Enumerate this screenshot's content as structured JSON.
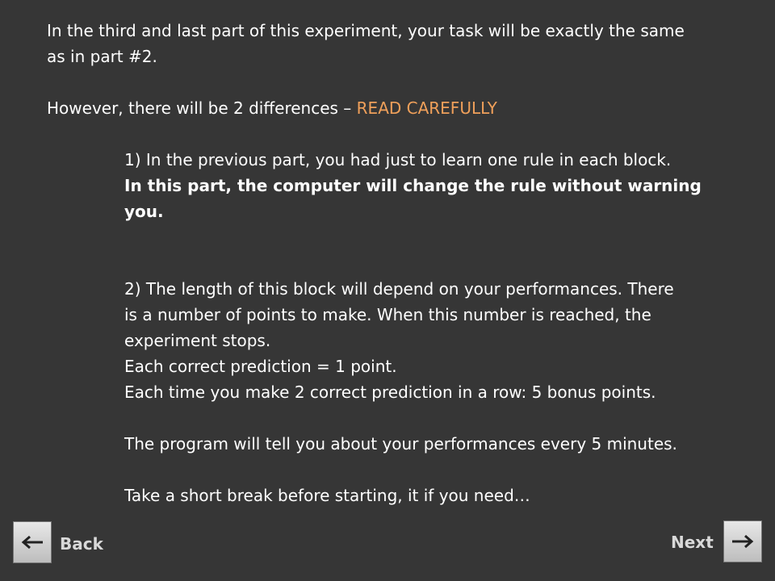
{
  "instructions": {
    "intro_line1": "In the third and last part of this experiment, your task will be exactly the same",
    "intro_line2": "as in part #2.",
    "however_prefix": "However, there will be 2 differences – ",
    "read_carefully": "READ CAREFULLY",
    "point1_line1": "1) In the previous part, you had just to learn one rule in each block.",
    "point1_bold_line1": "In this part, the computer will change the rule without warning",
    "point1_bold_line2": "you.",
    "point2_line1": "2) The length of this block will depend on your performances. There",
    "point2_line2": "is a number of points to make. When this number is reached, the",
    "point2_line3": "experiment stops.",
    "point2_line4": "Each correct prediction = 1 point.",
    "point2_line5": "Each time you make 2 correct prediction in a row: 5 bonus points.",
    "performance_line": "The program will tell you about your performances every 5 minutes.",
    "break_line": "Take a short break before starting, it if you need…"
  },
  "navigation": {
    "back_label": "Back",
    "next_label": "Next",
    "back_icon": "arrow-left-icon",
    "next_icon": "arrow-right-icon"
  },
  "colors": {
    "background": "#363636",
    "accent": "#f0a05a"
  }
}
